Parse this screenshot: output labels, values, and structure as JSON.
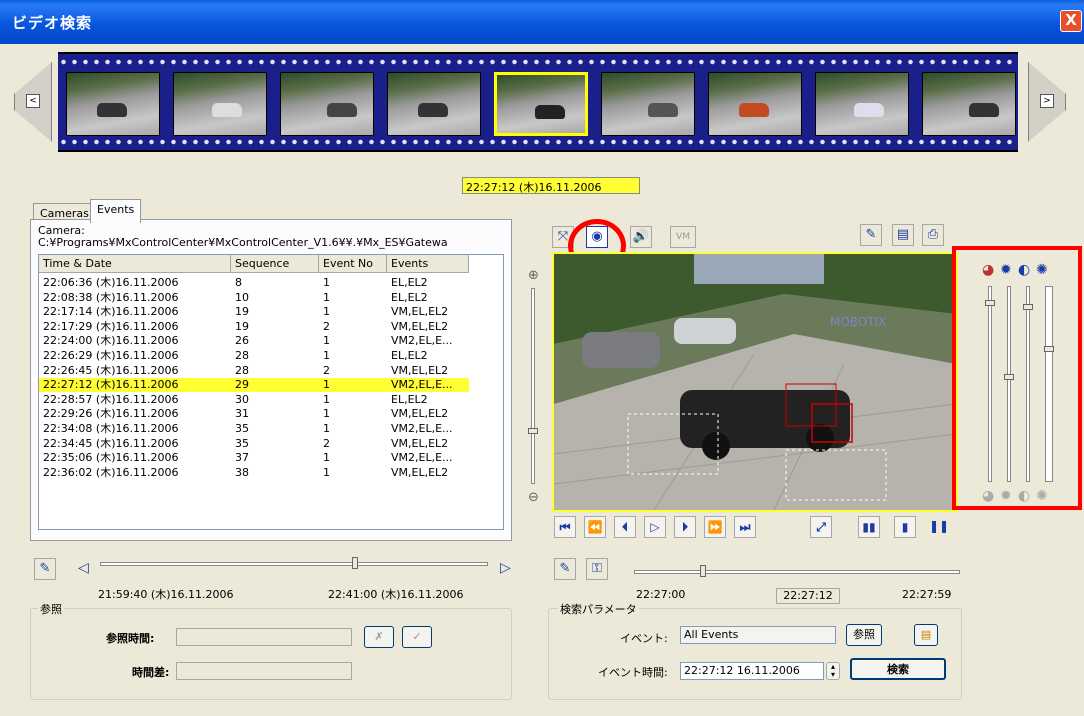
{
  "window": {
    "title": "ビデオ検索",
    "close_label": "X"
  },
  "filmstrip": {
    "prev_label": "<",
    "next_label": ">",
    "thumbnail_count": 9,
    "selected_index": 4
  },
  "current_time": "22:27:12 (木)16.11.2006",
  "tabs": [
    {
      "label": "Cameras"
    },
    {
      "label": "Events"
    }
  ],
  "camera": {
    "label": "Camera:",
    "path": "C:¥Programs¥MxControlCenter¥MxControlCenter_V1.6¥¥.¥Mx_ES¥Gatewa"
  },
  "events_table": {
    "columns": [
      "Time & Date",
      "Sequence",
      "Event No",
      "Events"
    ],
    "rows": [
      [
        "22:06:36 (木)16.11.2006",
        "8",
        "1",
        "EL,EL2"
      ],
      [
        "22:08:38 (木)16.11.2006",
        "10",
        "1",
        "EL,EL2"
      ],
      [
        "22:17:14 (木)16.11.2006",
        "19",
        "1",
        "VM,EL,EL2"
      ],
      [
        "22:17:29 (木)16.11.2006",
        "19",
        "2",
        "VM,EL,EL2"
      ],
      [
        "22:24:00 (木)16.11.2006",
        "26",
        "1",
        "VM2,EL,E..."
      ],
      [
        "22:26:29 (木)16.11.2006",
        "28",
        "1",
        "EL,EL2"
      ],
      [
        "22:26:45 (木)16.11.2006",
        "28",
        "2",
        "VM,EL,EL2"
      ],
      [
        "22:27:12 (木)16.11.2006",
        "29",
        "1",
        "VM2,EL,E..."
      ],
      [
        "22:28:57 (木)16.11.2006",
        "30",
        "1",
        "EL,EL2"
      ],
      [
        "22:29:26 (木)16.11.2006",
        "31",
        "1",
        "VM,EL,EL2"
      ],
      [
        "22:34:08 (木)16.11.2006",
        "35",
        "1",
        "VM2,EL,E..."
      ],
      [
        "22:34:45 (木)16.11.2006",
        "35",
        "2",
        "VM,EL,EL2"
      ],
      [
        "22:35:06 (木)16.11.2006",
        "37",
        "1",
        "VM2,EL,E..."
      ],
      [
        "22:36:02 (木)16.11.2006",
        "38",
        "1",
        "VM,EL,EL2"
      ]
    ],
    "selected_row": 7
  },
  "left_timeline": {
    "start": "21:59:40 (木)16.11.2006",
    "end": "22:41:00 (木)16.11.2006"
  },
  "reference": {
    "group_label": "参照",
    "time_label": "参照時間:",
    "diff_label": "時間差:"
  },
  "toolbar": {
    "vm_label": "VM"
  },
  "video": {
    "watermark": "MOBOTIX"
  },
  "playback": {
    "buttons": [
      "⏮",
      "⏪",
      "⏴",
      "▷",
      "⏵",
      "⏩",
      "⏭"
    ]
  },
  "right_timeline": {
    "start": "22:27:00",
    "current": "22:27:12",
    "end": "22:27:59"
  },
  "search": {
    "group_label": "検索パラメータ",
    "event_label": "イベント:",
    "event_value": "All Events",
    "browse_button": "参照",
    "event_time_label": "イベント時間:",
    "event_time_value": "22:27:12 16.11.2006",
    "search_button": "検索"
  },
  "image_controls": {
    "icons": [
      "color-icon",
      "brightness-icon",
      "contrast-icon",
      "saturation-icon"
    ]
  }
}
